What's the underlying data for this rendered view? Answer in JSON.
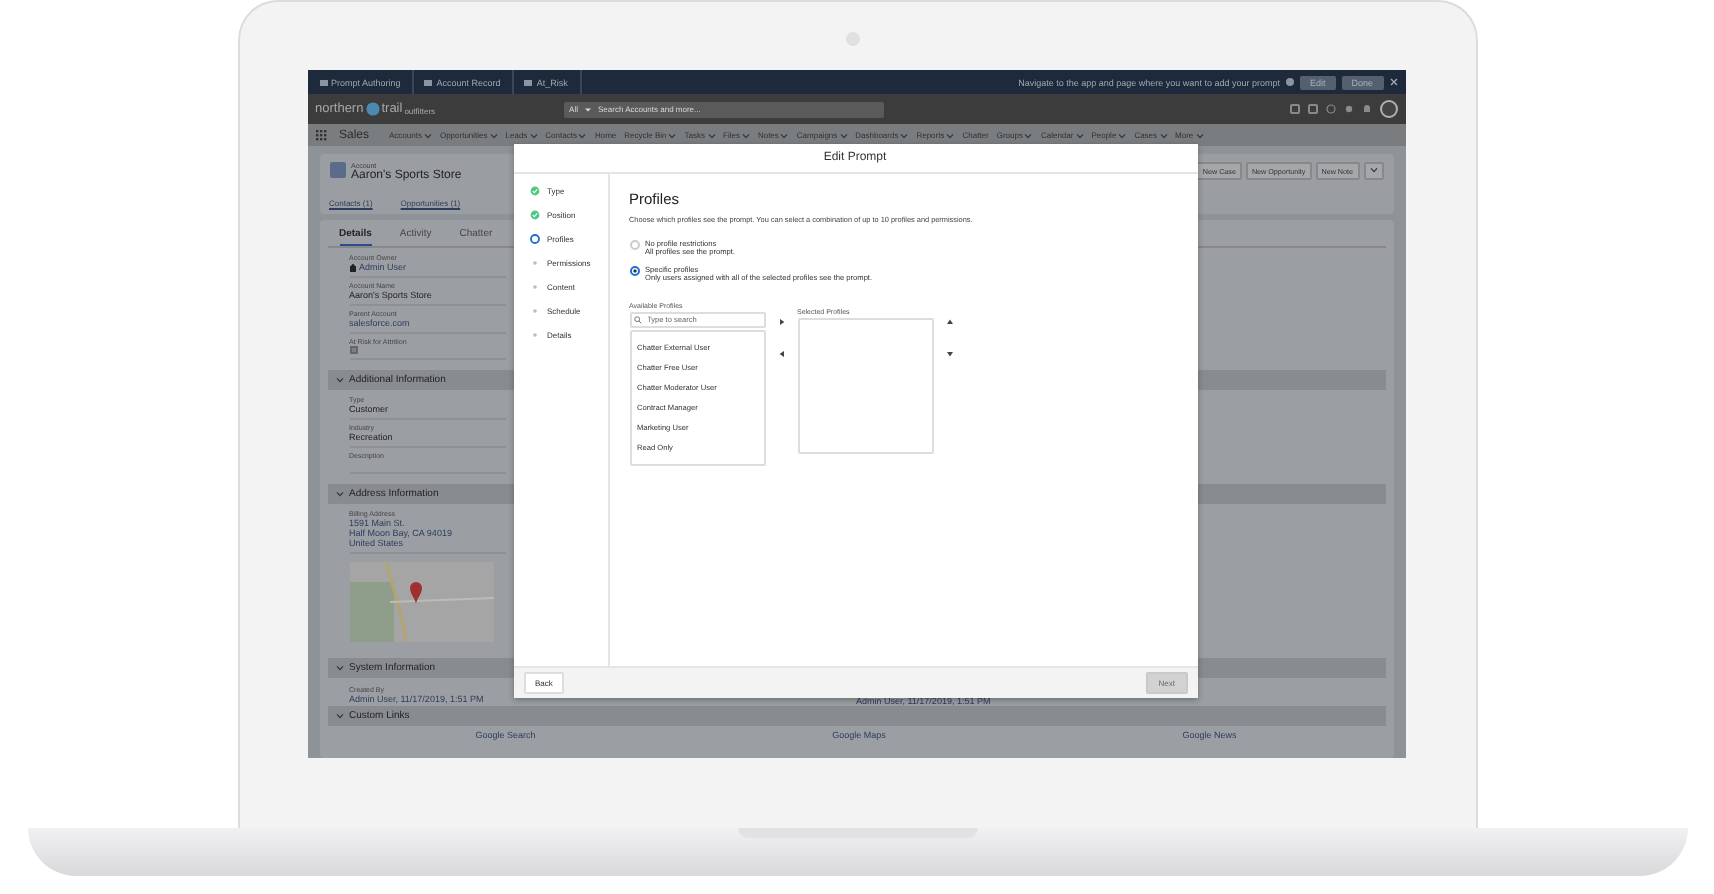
{
  "app_bar": {
    "tabs": [
      {
        "label": "Prompt Authoring"
      },
      {
        "label": "Account Record"
      },
      {
        "label": "At_Risk"
      }
    ],
    "hint": "Navigate to the app and page where you want to add your prompt",
    "buttons": [
      "Edit",
      "Done"
    ]
  },
  "header": {
    "logo": "northern",
    "logo_tail": "trail",
    "logo_sub": "outfitters",
    "search_scope": "All",
    "search_placeholder": "Search Accounts and more..."
  },
  "nav": {
    "app": "Sales",
    "items": [
      {
        "label": "Accounts",
        "menu": true
      },
      {
        "label": "Opportunities",
        "menu": true
      },
      {
        "label": "Leads",
        "menu": true
      },
      {
        "label": "Contacts",
        "menu": true
      },
      {
        "label": "Home",
        "menu": false
      },
      {
        "label": "Recycle Bin",
        "menu": true
      },
      {
        "label": "Tasks",
        "menu": true
      },
      {
        "label": "Files",
        "menu": true
      },
      {
        "label": "Notes",
        "menu": true
      },
      {
        "label": "Campaigns",
        "menu": true
      },
      {
        "label": "Dashboards",
        "menu": true
      },
      {
        "label": "Reports",
        "menu": true
      },
      {
        "label": "Chatter",
        "menu": false
      },
      {
        "label": "Groups",
        "menu": true
      },
      {
        "label": "Calendar",
        "menu": true
      },
      {
        "label": "People",
        "menu": true
      },
      {
        "label": "Cases",
        "menu": true
      },
      {
        "label": "More",
        "menu": true
      }
    ]
  },
  "record": {
    "type": "Account",
    "name": "Aaron's Sports Store",
    "related": [
      {
        "label": "Contacts (1)"
      },
      {
        "label": "Opportunities (1)"
      }
    ],
    "actions": [
      "New Case",
      "New Opportunity",
      "New Note"
    ]
  },
  "detail_tabs": [
    {
      "label": "Details",
      "selected": true
    },
    {
      "label": "Activity",
      "selected": false
    },
    {
      "label": "Chatter",
      "selected": false
    }
  ],
  "fields": [
    {
      "kind": "user",
      "label": "Account Owner",
      "value": "Admin User"
    },
    {
      "kind": "text",
      "label": "Account Name",
      "value": "Aaron's Sports Store"
    },
    {
      "kind": "link",
      "label": "Parent Account",
      "value": "salesforce.com"
    },
    {
      "kind": "checkbox",
      "label": "At Risk for Attrition",
      "checked": true
    }
  ],
  "sections": [
    {
      "title": "Additional Information",
      "fields": [
        {
          "kind": "text",
          "label": "Type",
          "value": "Customer"
        },
        {
          "kind": "text",
          "label": "Industry",
          "value": "Recreation"
        },
        {
          "kind": "text",
          "label": "Description"
        }
      ]
    },
    {
      "title": "Address Information",
      "fields": [
        {
          "kind": "address",
          "label": "Billing Address",
          "lines": [
            "1591 Main St.",
            "Half Moon Bay, CA 94019",
            "United States"
          ]
        }
      ]
    }
  ],
  "system": {
    "title": "System Information",
    "created_label": "Created By",
    "created": "Admin User, 11/17/2019, 1:51 PM",
    "modified": "Admin User, 11/17/2019, 1:51 PM"
  },
  "custom_links": {
    "title": "Custom Links",
    "links": [
      "Google Search",
      "Google Maps",
      "Google News"
    ]
  },
  "modal": {
    "title": "Edit Prompt",
    "steps": [
      {
        "label": "Type",
        "done": true,
        "current": false
      },
      {
        "label": "Position",
        "done": true,
        "current": false
      },
      {
        "label": "Profiles",
        "done": false,
        "current": true
      },
      {
        "label": "Permissions",
        "done": false,
        "current": false
      },
      {
        "label": "Content",
        "done": false,
        "current": false
      },
      {
        "label": "Schedule",
        "done": false,
        "current": false
      },
      {
        "label": "Details",
        "done": false,
        "current": false
      }
    ],
    "heading": "Profiles",
    "description": "Choose which profiles see the prompt. You can select a combination of up to 10 profiles and permissions.",
    "options": [
      {
        "label": "No profile restrictions",
        "help": "All profiles see the prompt.",
        "selected": false
      },
      {
        "label": "Specific profiles",
        "help": "Only users assigned with all of the selected profiles see the prompt.",
        "selected": true
      }
    ],
    "available_label": "Available Profiles",
    "search_placeholder": "Type to search",
    "available": [
      "Chatter External User",
      "Chatter Free User",
      "Chatter Moderator User",
      "Contract Manager",
      "Marketing User",
      "Read Only"
    ],
    "selected_label": "Selected Profiles",
    "back": "Back",
    "next": {
      "label": "Next",
      "disabled": true
    }
  }
}
